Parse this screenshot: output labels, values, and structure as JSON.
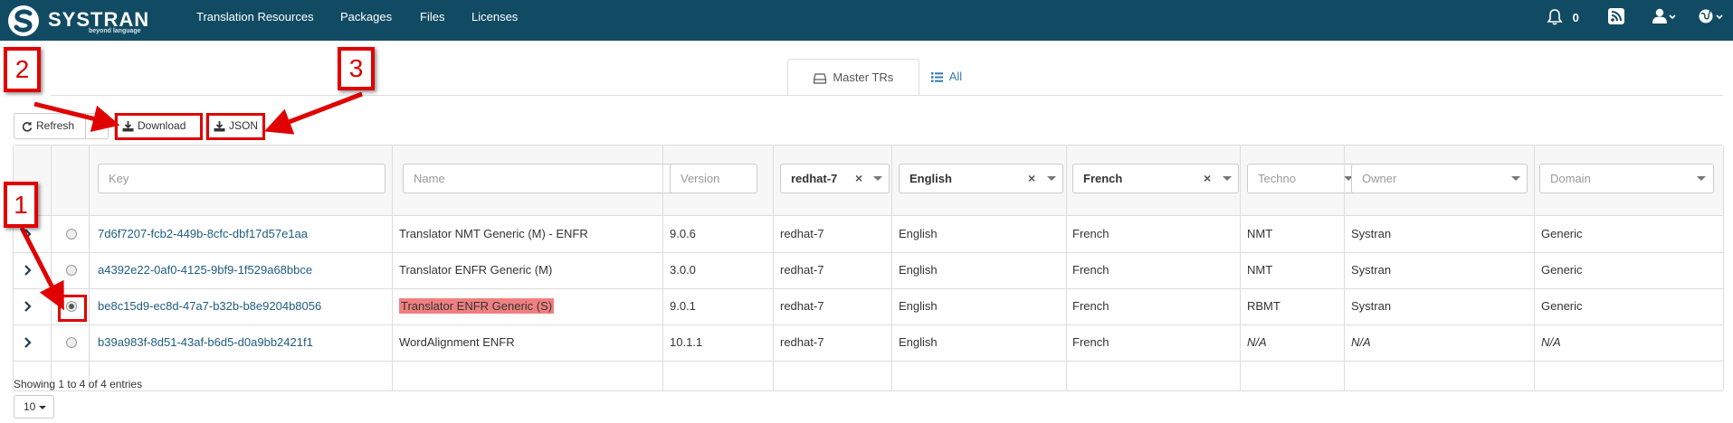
{
  "brand": {
    "name": "SYSTRAN",
    "tagline": "beyond language"
  },
  "nav": {
    "links": [
      "Translation Resources",
      "Packages",
      "Files",
      "Licenses"
    ],
    "notification_count": "0",
    "colors": {
      "bar": "#114b63"
    }
  },
  "tabs": {
    "master": "Master TRs",
    "all": "All"
  },
  "toolbar": {
    "refresh": "Refresh",
    "download": "Download",
    "json": "JSON"
  },
  "filters": {
    "key_placeholder": "Key",
    "name_placeholder": "Name",
    "version_placeholder": "Version",
    "platform": "redhat-7",
    "source": "English",
    "target": "French",
    "techno_placeholder": "Techno",
    "owner_placeholder": "Owner",
    "domain_placeholder": "Domain"
  },
  "rows": [
    {
      "key": "7d6f7207-fcb2-449b-8cfc-dbf17d57e1aa",
      "name": "Translator NMT Generic (M) - ENFR",
      "version": "9.0.6",
      "platform": "redhat-7",
      "source": "English",
      "target": "French",
      "techno": "NMT",
      "owner": "Systran",
      "domain": "Generic",
      "selected": false
    },
    {
      "key": "a4392e22-0af0-4125-9bf9-1f529a68bbce",
      "name": "Translator ENFR Generic (M)",
      "version": "3.0.0",
      "platform": "redhat-7",
      "source": "English",
      "target": "French",
      "techno": "NMT",
      "owner": "Systran",
      "domain": "Generic",
      "selected": false
    },
    {
      "key": "be8c15d9-ec8d-47a7-b32b-b8e9204b8056",
      "name": "Translator ENFR Generic (S)",
      "version": "9.0.1",
      "platform": "redhat-7",
      "source": "English",
      "target": "French",
      "techno": "RBMT",
      "owner": "Systran",
      "domain": "Generic",
      "selected": true
    },
    {
      "key": "b39a983f-8d51-43af-b6d5-d0a9bb2421f1",
      "name": "WordAlignment ENFR",
      "version": "10.1.1",
      "platform": "redhat-7",
      "source": "English",
      "target": "French",
      "techno": "N/A",
      "owner": "N/A",
      "domain": "N/A",
      "selected": false
    }
  ],
  "footer": {
    "summary": "Showing 1 to 4 of 4 entries",
    "page_size": "10"
  },
  "annotations": {
    "callout_1": "1",
    "callout_2": "2",
    "callout_3": "3",
    "color": "#e00000"
  }
}
